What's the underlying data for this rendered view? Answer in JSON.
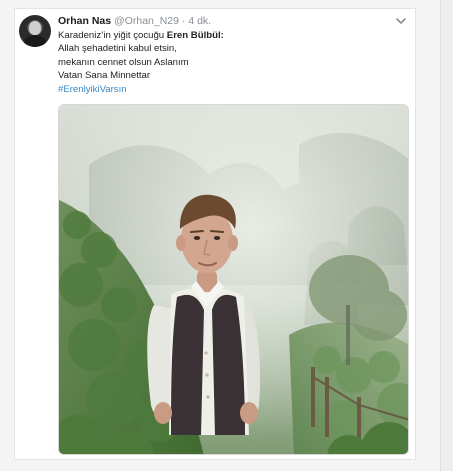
{
  "tweet": {
    "author_name": "Orhan Nas",
    "author_handle": "@Orhan_N29",
    "separator": "·",
    "timestamp": "4 dk.",
    "line1_prefix": "Karadeniz’in yiğit çocuğu ",
    "line1_bold": "Eren Bülbül",
    "line1_suffix": ":",
    "line2": "Allah şehadetini kabul etsin,",
    "line3": "mekanın cennet olsun Aslanım",
    "line4": "Vatan Sana Minnettar",
    "hashtag": "#ErenlyikiVarsın"
  },
  "icons": {
    "menu": "chevron-down-icon",
    "avatar": "avatar"
  }
}
